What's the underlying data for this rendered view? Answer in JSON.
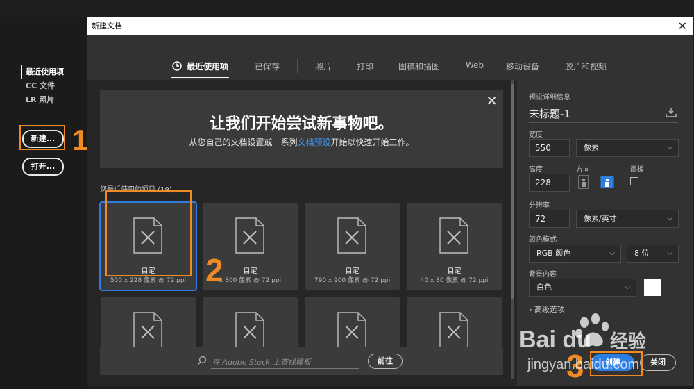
{
  "left_nav": {
    "items": [
      {
        "label": "最近使用项",
        "active": true
      },
      {
        "label": "CC 文件",
        "active": false
      },
      {
        "label": "LR 照片",
        "active": false
      }
    ],
    "new_button": "新建...",
    "open_button": "打开..."
  },
  "dialog": {
    "title": "新建文档",
    "close_glyph": "✕",
    "tabs": [
      {
        "label": "最近使用项",
        "active": true
      },
      {
        "label": "已保存"
      },
      {
        "label": "照片"
      },
      {
        "label": "打印"
      },
      {
        "label": "图稿和插图"
      },
      {
        "label": "Web"
      },
      {
        "label": "移动设备"
      },
      {
        "label": "胶片和视频"
      }
    ]
  },
  "banner": {
    "heading": "让我们开始尝试新事物吧。",
    "text_before": "从您自己的文档设置或一系列",
    "link": "文档预设",
    "text_after": "开始以快速开始工作。",
    "close_glyph": "✕"
  },
  "recent": {
    "label": "您最近使用的项目",
    "count": "(19)",
    "items": [
      {
        "name": "自定",
        "size": "550 x 228 像素 @ 72 ppi",
        "selected": true
      },
      {
        "name": "自定",
        "size": "x 800 像素 @ 72 ppi"
      },
      {
        "name": "自定",
        "size": "790 x 900 像素 @ 72 ppi"
      },
      {
        "name": "自定",
        "size": "40 x 80 像素 @ 72 ppi"
      },
      {
        "name": "",
        "size": ""
      },
      {
        "name": "",
        "size": ""
      },
      {
        "name": "",
        "size": ""
      },
      {
        "name": "",
        "size": ""
      }
    ]
  },
  "search": {
    "placeholder": "在 Adobe Stock 上查找模板",
    "go_label": "前往"
  },
  "preset": {
    "section_label": "预设详细信息",
    "doc_title": "未标题-1",
    "width_label": "宽度",
    "width_value": "550",
    "width_unit": "像素",
    "height_label": "高度",
    "height_value": "228",
    "orientation_label": "方向",
    "artboard_label": "画板",
    "resolution_label": "分辨率",
    "resolution_value": "72",
    "resolution_unit": "像素/英寸",
    "color_mode_label": "颜色模式",
    "color_mode": "RGB 颜色",
    "bit_depth": "8 位",
    "background_label": "背景内容",
    "background": "白色",
    "advanced_label": "高级选项",
    "create_button": "创建",
    "close_button": "关闭"
  },
  "annotations": {
    "step1": "1",
    "step2": "2",
    "step3": "3"
  },
  "watermark": {
    "logo": "Bai  du",
    "cn": "经验",
    "url": "jingyan.baidu.com"
  },
  "colors": {
    "accent": "#2d7ee3",
    "annotation": "#f08a24",
    "link": "#3e9bff"
  }
}
